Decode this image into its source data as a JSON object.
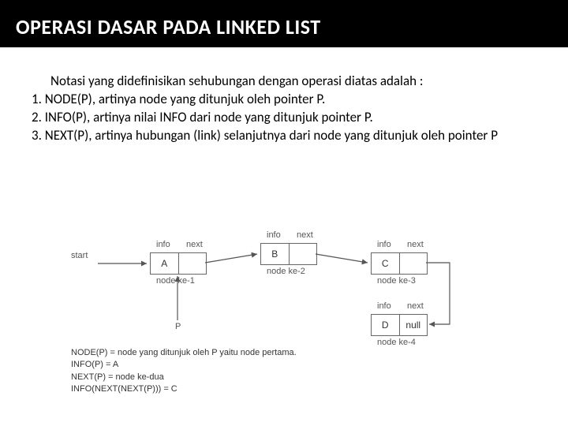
{
  "title": "OPERASI DASAR PADA LINKED LIST",
  "intro": "Notasi yang didefinisikan sehubungan dengan operasi diatas adalah :",
  "items": [
    "1. NODE(P), artinya node yang ditunjuk oleh pointer P.",
    "2. INFO(P), artinya nilai INFO dari node yang ditunjuk pointer P.",
    "3. NEXT(P), artinya hubungan (link) selanjutnya dari node yang ditunjuk oleh pointer P"
  ],
  "diagram": {
    "start": "start",
    "pointer": "P",
    "col_info": "info",
    "col_next": "next",
    "null": "null",
    "nodes": [
      {
        "val": "A",
        "label": "node ke-1"
      },
      {
        "val": "B",
        "label": "node ke-2"
      },
      {
        "val": "C",
        "label": "node ke-3"
      },
      {
        "val": "D",
        "label": "node ke-4"
      }
    ]
  },
  "legend": [
    "NODE(P) = node yang ditunjuk oleh P yaitu node pertama.",
    "INFO(P) = A",
    "NEXT(P) = node ke-dua",
    "INFO(NEXT(NEXT(P))) = C"
  ]
}
